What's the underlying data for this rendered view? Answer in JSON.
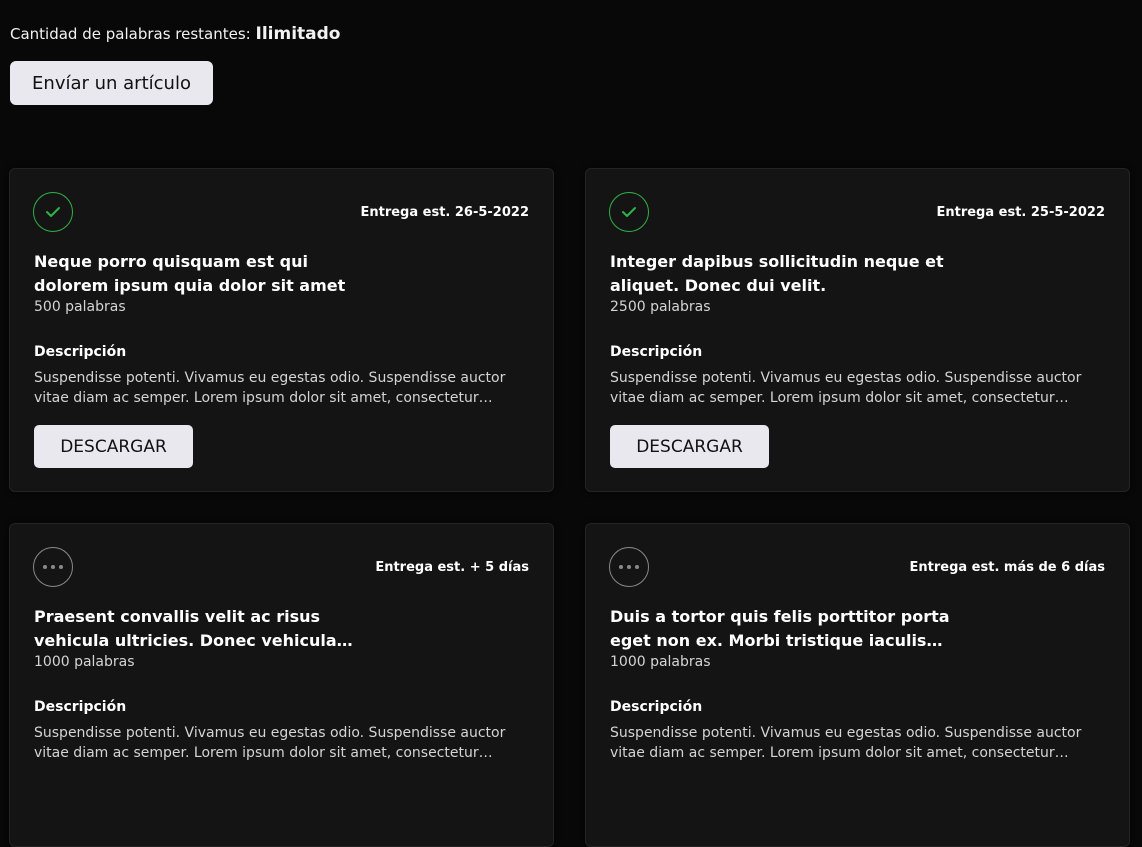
{
  "quota": {
    "label": "Cantidad de palabras restantes:",
    "value": "Ilimitado"
  },
  "submit_label": "Envíar un artículo",
  "cards": [
    {
      "status": "check-circle-icon",
      "eta": "Entrega est. 26-5-2022",
      "title": "Neque porro quisquam est qui dolorem ipsum quia dolor sit amet",
      "words": "500 palabras",
      "desc_label": "Descripción",
      "desc": "Suspendisse potenti. Vivamus eu egestas odio. Suspendisse auctor vitae diam ac semper. Lorem ipsum dolor sit amet, consectetur adipiscing elit.",
      "button": "DESCARGAR"
    },
    {
      "status": "check-circle-icon",
      "eta": "Entrega est. 25-5-2022",
      "title": "Integer dapibus sollicitudin neque et aliquet. Donec dui velit.",
      "words": "2500 palabras",
      "desc_label": "Descripción",
      "desc": "Suspendisse potenti. Vivamus eu egestas odio. Suspendisse auctor vitae diam ac semper. Lorem ipsum dolor sit amet, consectetur adipiscing elit.",
      "button": "DESCARGAR"
    },
    {
      "status": "pending-dots-icon",
      "eta": "Entrega est. + 5 días",
      "title": "Praesent convallis velit ac risus vehicula ultricies. Donec vehicula sem sed",
      "words": "1000 palabras",
      "desc_label": "Descripción",
      "desc": "Suspendisse potenti. Vivamus eu egestas odio. Suspendisse auctor vitae diam ac semper. Lorem ipsum dolor sit amet, consectetur adipiscing elit.",
      "button": ""
    },
    {
      "status": "pending-dots-icon",
      "eta": "Entrega est. más de 6 días",
      "title": "Duis a tortor quis felis porttitor porta eget non ex. Morbi tristique iaculis nunc",
      "words": "1000 palabras",
      "desc_label": "Descripción",
      "desc": "Suspendisse potenti. Vivamus eu egestas odio. Suspendisse auctor vitae diam ac semper. Lorem ipsum dolor sit amet, consectetur adipiscing elit.",
      "button": ""
    }
  ],
  "colors": {
    "background": "#080808",
    "card": "#141414",
    "check_green": "#2fb347",
    "button_bg": "#e9e8ee"
  }
}
